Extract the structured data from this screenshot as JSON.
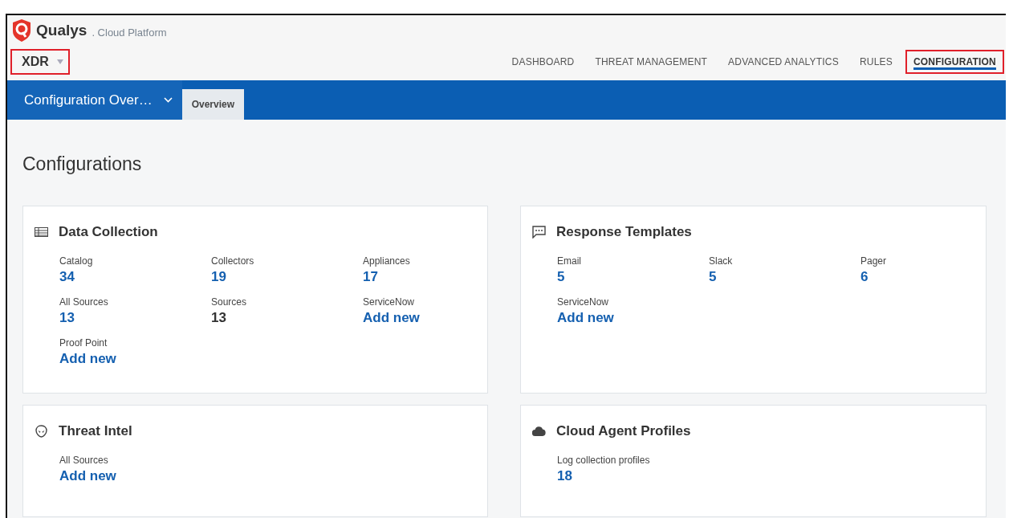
{
  "brand": {
    "name": "Qualys",
    "suffix": ". Cloud Platform"
  },
  "app_switcher": {
    "label": "XDR",
    "highlighted": true
  },
  "nav": [
    {
      "label": "DASHBOARD",
      "selected": false,
      "highlighted": false
    },
    {
      "label": "THREAT MANAGEMENT",
      "selected": false,
      "highlighted": false
    },
    {
      "label": "ADVANCED ANALYTICS",
      "selected": false,
      "highlighted": false
    },
    {
      "label": "RULES",
      "selected": false,
      "highlighted": false
    },
    {
      "label": "CONFIGURATION",
      "selected": true,
      "highlighted": true
    }
  ],
  "subbar": {
    "menu": "Configuration Over…",
    "tabs": [
      {
        "label": "Overview",
        "selected": true
      }
    ]
  },
  "page_title": "Configurations",
  "cards": [
    {
      "title": "Data Collection",
      "kind": "table",
      "items": [
        {
          "label": "Catalog",
          "value": "34",
          "linked": true
        },
        {
          "label": "Collectors",
          "value": "19",
          "linked": true
        },
        {
          "label": "Appliances",
          "value": "17",
          "linked": true
        },
        {
          "label": "All Sources",
          "value": "13",
          "linked": true
        },
        {
          "label": "Sources",
          "value": "13",
          "linked": false
        },
        {
          "label": "ServiceNow",
          "value": "Add new",
          "linked": true
        },
        {
          "label": "Proof Point",
          "value": "Add new",
          "linked": true
        }
      ]
    },
    {
      "title": "Response Templates",
      "kind": "chat",
      "items": [
        {
          "label": "Email",
          "value": "5",
          "linked": true
        },
        {
          "label": "Slack",
          "value": "5",
          "linked": true
        },
        {
          "label": "Pager",
          "value": "6",
          "linked": true
        },
        {
          "label": "ServiceNow",
          "value": "Add new",
          "linked": true
        }
      ]
    },
    {
      "title": "Threat Intel",
      "kind": "alien",
      "items": [
        {
          "label": "All Sources",
          "value": "Add new",
          "linked": true
        }
      ]
    },
    {
      "title": "Cloud Agent Profiles",
      "kind": "cloud",
      "items": [
        {
          "label": "Log collection profiles",
          "value": "18",
          "linked": true
        }
      ]
    }
  ]
}
